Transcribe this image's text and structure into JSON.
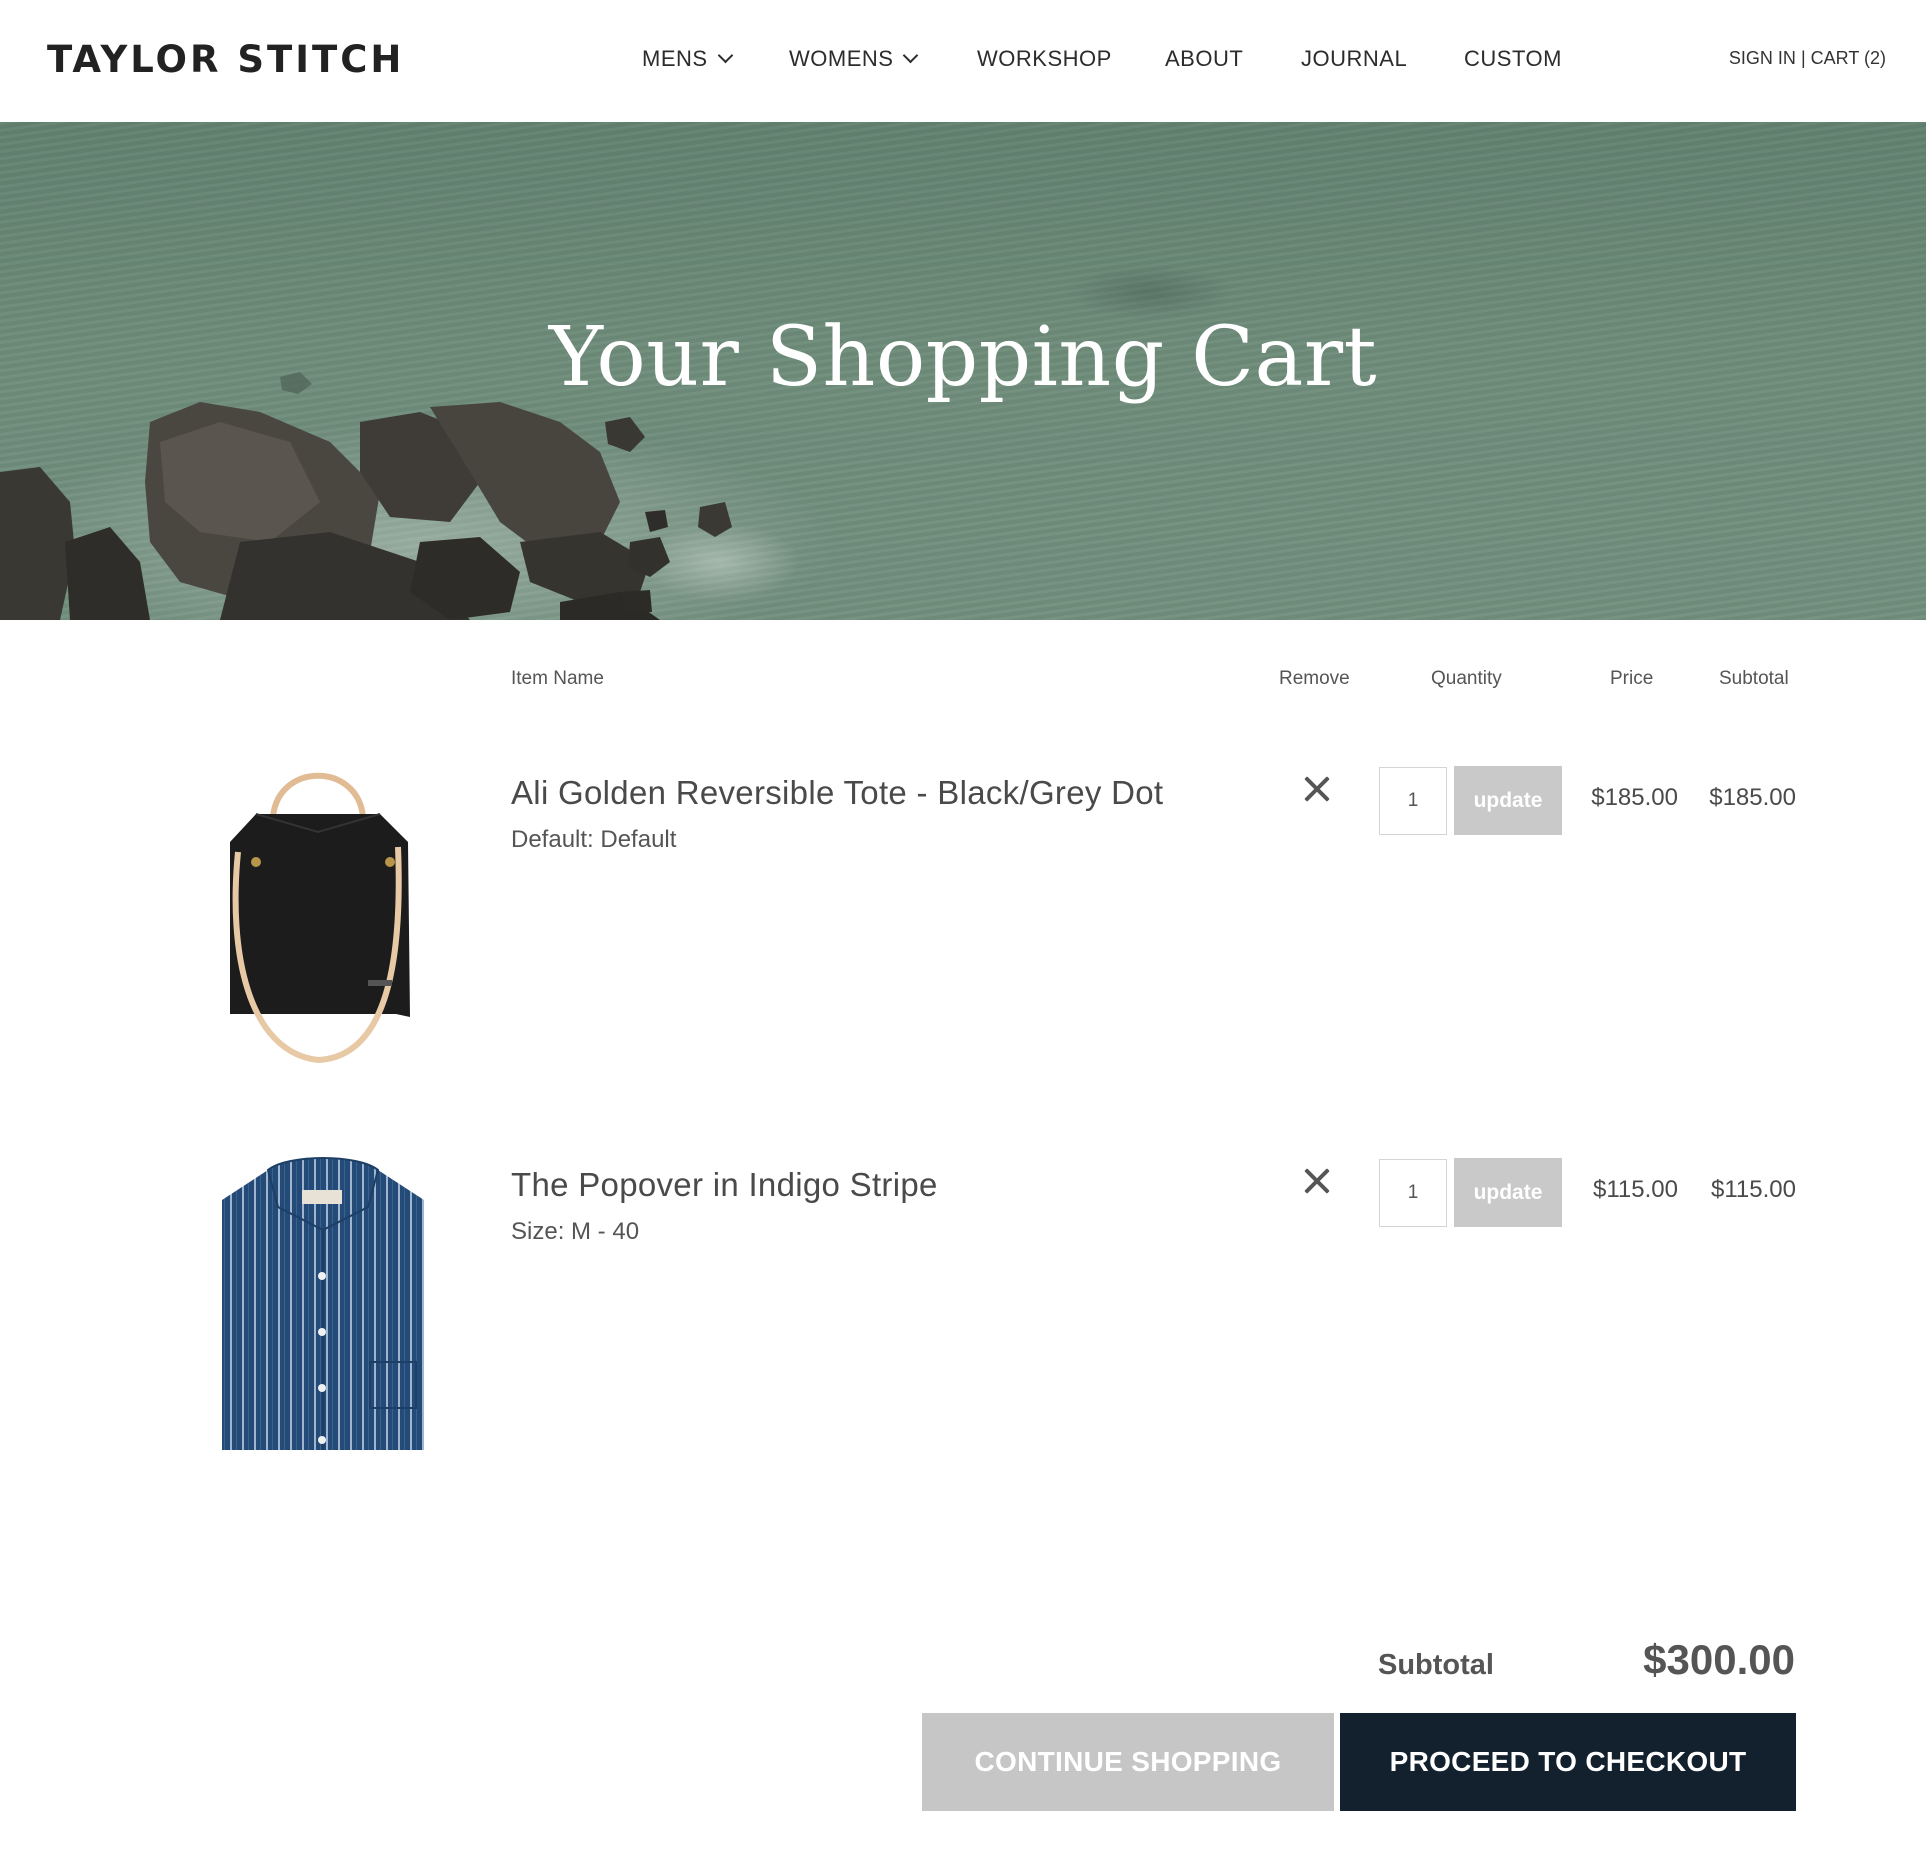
{
  "header": {
    "logo": "TAYLOR STITCH",
    "nav": [
      {
        "label": "MENS"
      },
      {
        "label": "WOMENS"
      },
      {
        "label": "WORKSHOP"
      },
      {
        "label": "ABOUT"
      },
      {
        "label": "JOURNAL"
      },
      {
        "label": "CUSTOM"
      }
    ],
    "sign_in": "SIGN IN",
    "separator": "|",
    "cart": "CART (2)"
  },
  "hero": {
    "title": "Your Shopping Cart"
  },
  "table": {
    "columns": {
      "item_name": "Item Name",
      "remove": "Remove",
      "quantity": "Quantity",
      "price": "Price",
      "subtotal": "Subtotal"
    },
    "items": [
      {
        "name": "Ali Golden Reversible Tote - Black/Grey Dot",
        "variant": "Default: Default",
        "quantity": "1",
        "update_label": "update",
        "price": "$185.00",
        "subtotal": "$185.00",
        "image_icon": "tote-bag-image"
      },
      {
        "name": "The Popover in Indigo Stripe",
        "variant": "Size: M - 40",
        "quantity": "1",
        "update_label": "update",
        "price": "$115.00",
        "subtotal": "$115.00",
        "image_icon": "striped-shirt-image"
      }
    ]
  },
  "summary": {
    "label": "Subtotal",
    "value": "$300.00"
  },
  "actions": {
    "continue": "CONTINUE SHOPPING",
    "checkout": "PROCEED TO CHECKOUT"
  },
  "colors": {
    "checkout_bg": "#13202e",
    "muted_button": "#c6c6c6",
    "hero_water": "#6e8b79"
  }
}
